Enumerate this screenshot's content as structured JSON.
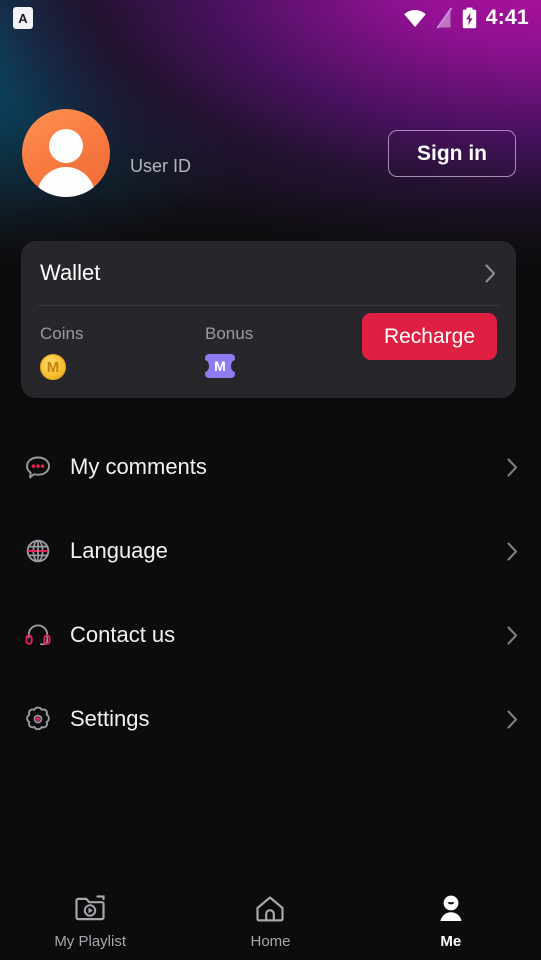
{
  "statusbar": {
    "app_badge_letter": "A",
    "time": "4:41",
    "icons": [
      "wifi-icon",
      "signal-off-icon",
      "battery-charging-icon"
    ]
  },
  "profile": {
    "avatar_name": "default-user-avatar",
    "user_id_label": "User ID",
    "sign_in_label": "Sign in",
    "avatar_color": "#f87c41"
  },
  "wallet": {
    "title": "Wallet",
    "coins_label": "Coins",
    "coins_icon_letter": "M",
    "coins_icon_color": "#f7bf34",
    "bonus_label": "Bonus",
    "bonus_icon_letter": "M",
    "bonus_icon_color": "#8d7bf0",
    "recharge_label": "Recharge",
    "recharge_color": "#e02043",
    "card_color": "#26262b"
  },
  "menu": {
    "items": [
      {
        "label": "My comments",
        "icon": "comment-bubble-icon"
      },
      {
        "label": "Language",
        "icon": "globe-icon"
      },
      {
        "label": "Contact us",
        "icon": "headset-icon"
      },
      {
        "label": "Settings",
        "icon": "gear-icon"
      }
    ],
    "accent_color": "#e81f55"
  },
  "tabbar": {
    "items": [
      {
        "label": "My Playlist",
        "icon": "playlist-folder-icon",
        "active": false
      },
      {
        "label": "Home",
        "icon": "home-icon",
        "active": false
      },
      {
        "label": "Me",
        "icon": "person-icon",
        "active": true
      }
    ]
  }
}
